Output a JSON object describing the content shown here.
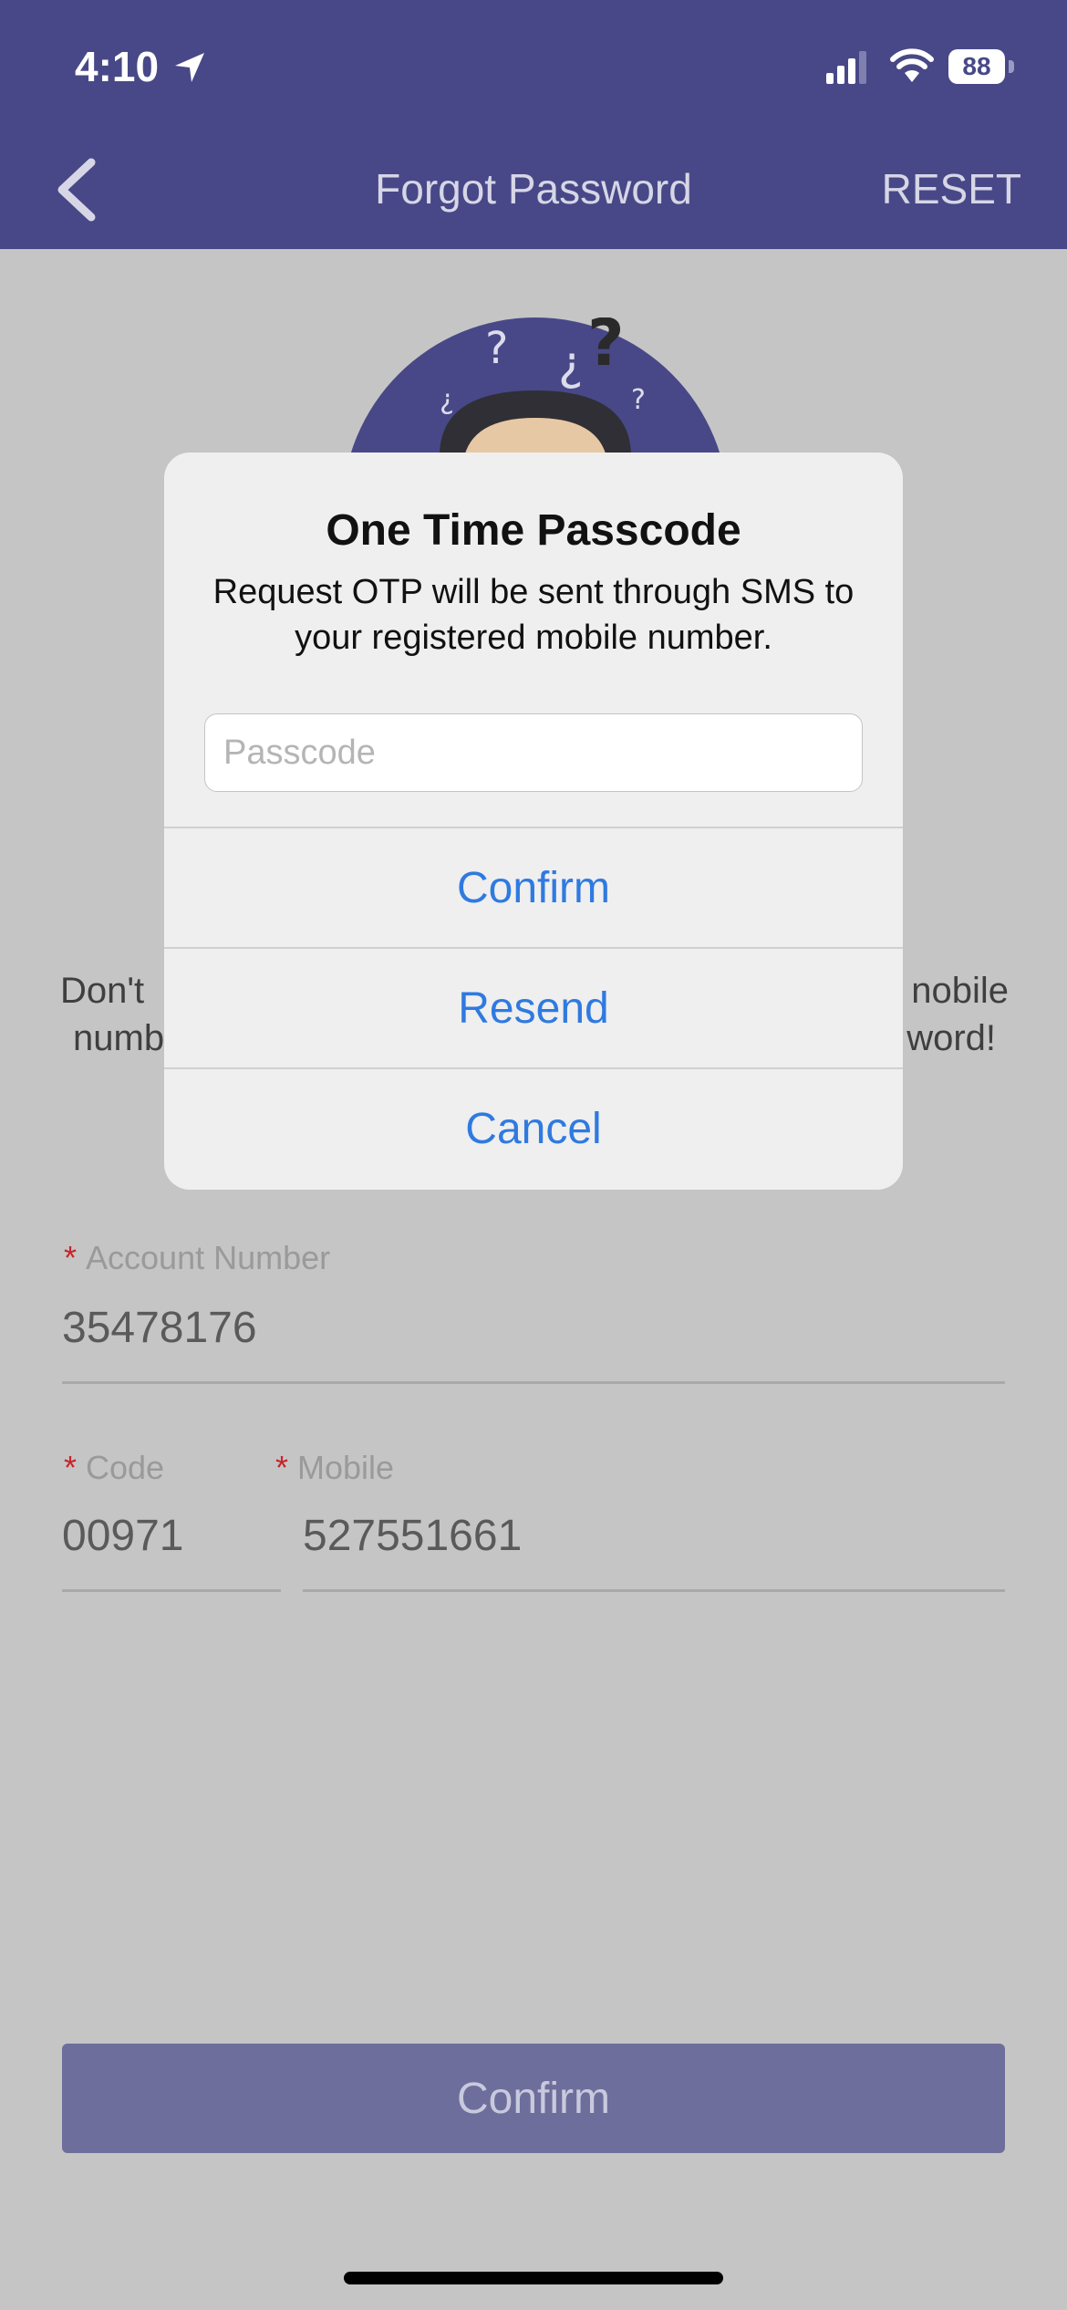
{
  "status_bar": {
    "time": "4:10",
    "battery": "88"
  },
  "header": {
    "title": "Forgot Password",
    "reset_label": "RESET"
  },
  "description": {
    "line1_left": "Don't",
    "line1_right": "nobile",
    "line2_left": "numb",
    "line2_right": "word!"
  },
  "form": {
    "account_label": "Account Number",
    "account_value": "35478176",
    "code_label": "Code",
    "code_value": "00971",
    "mobile_label": "Mobile",
    "mobile_value": "527551661",
    "required_marker": "*"
  },
  "main_button": {
    "label": "Confirm"
  },
  "dialog": {
    "title": "One Time Passcode",
    "message": "Request OTP will be sent through SMS to your registered mobile number.",
    "input_placeholder": "Passcode",
    "input_value": "",
    "actions": [
      "Confirm",
      "Resend",
      "Cancel"
    ]
  },
  "colors": {
    "header_bg": "#484888",
    "action_blue": "#2f7ae0",
    "required_red": "#c8242a"
  }
}
